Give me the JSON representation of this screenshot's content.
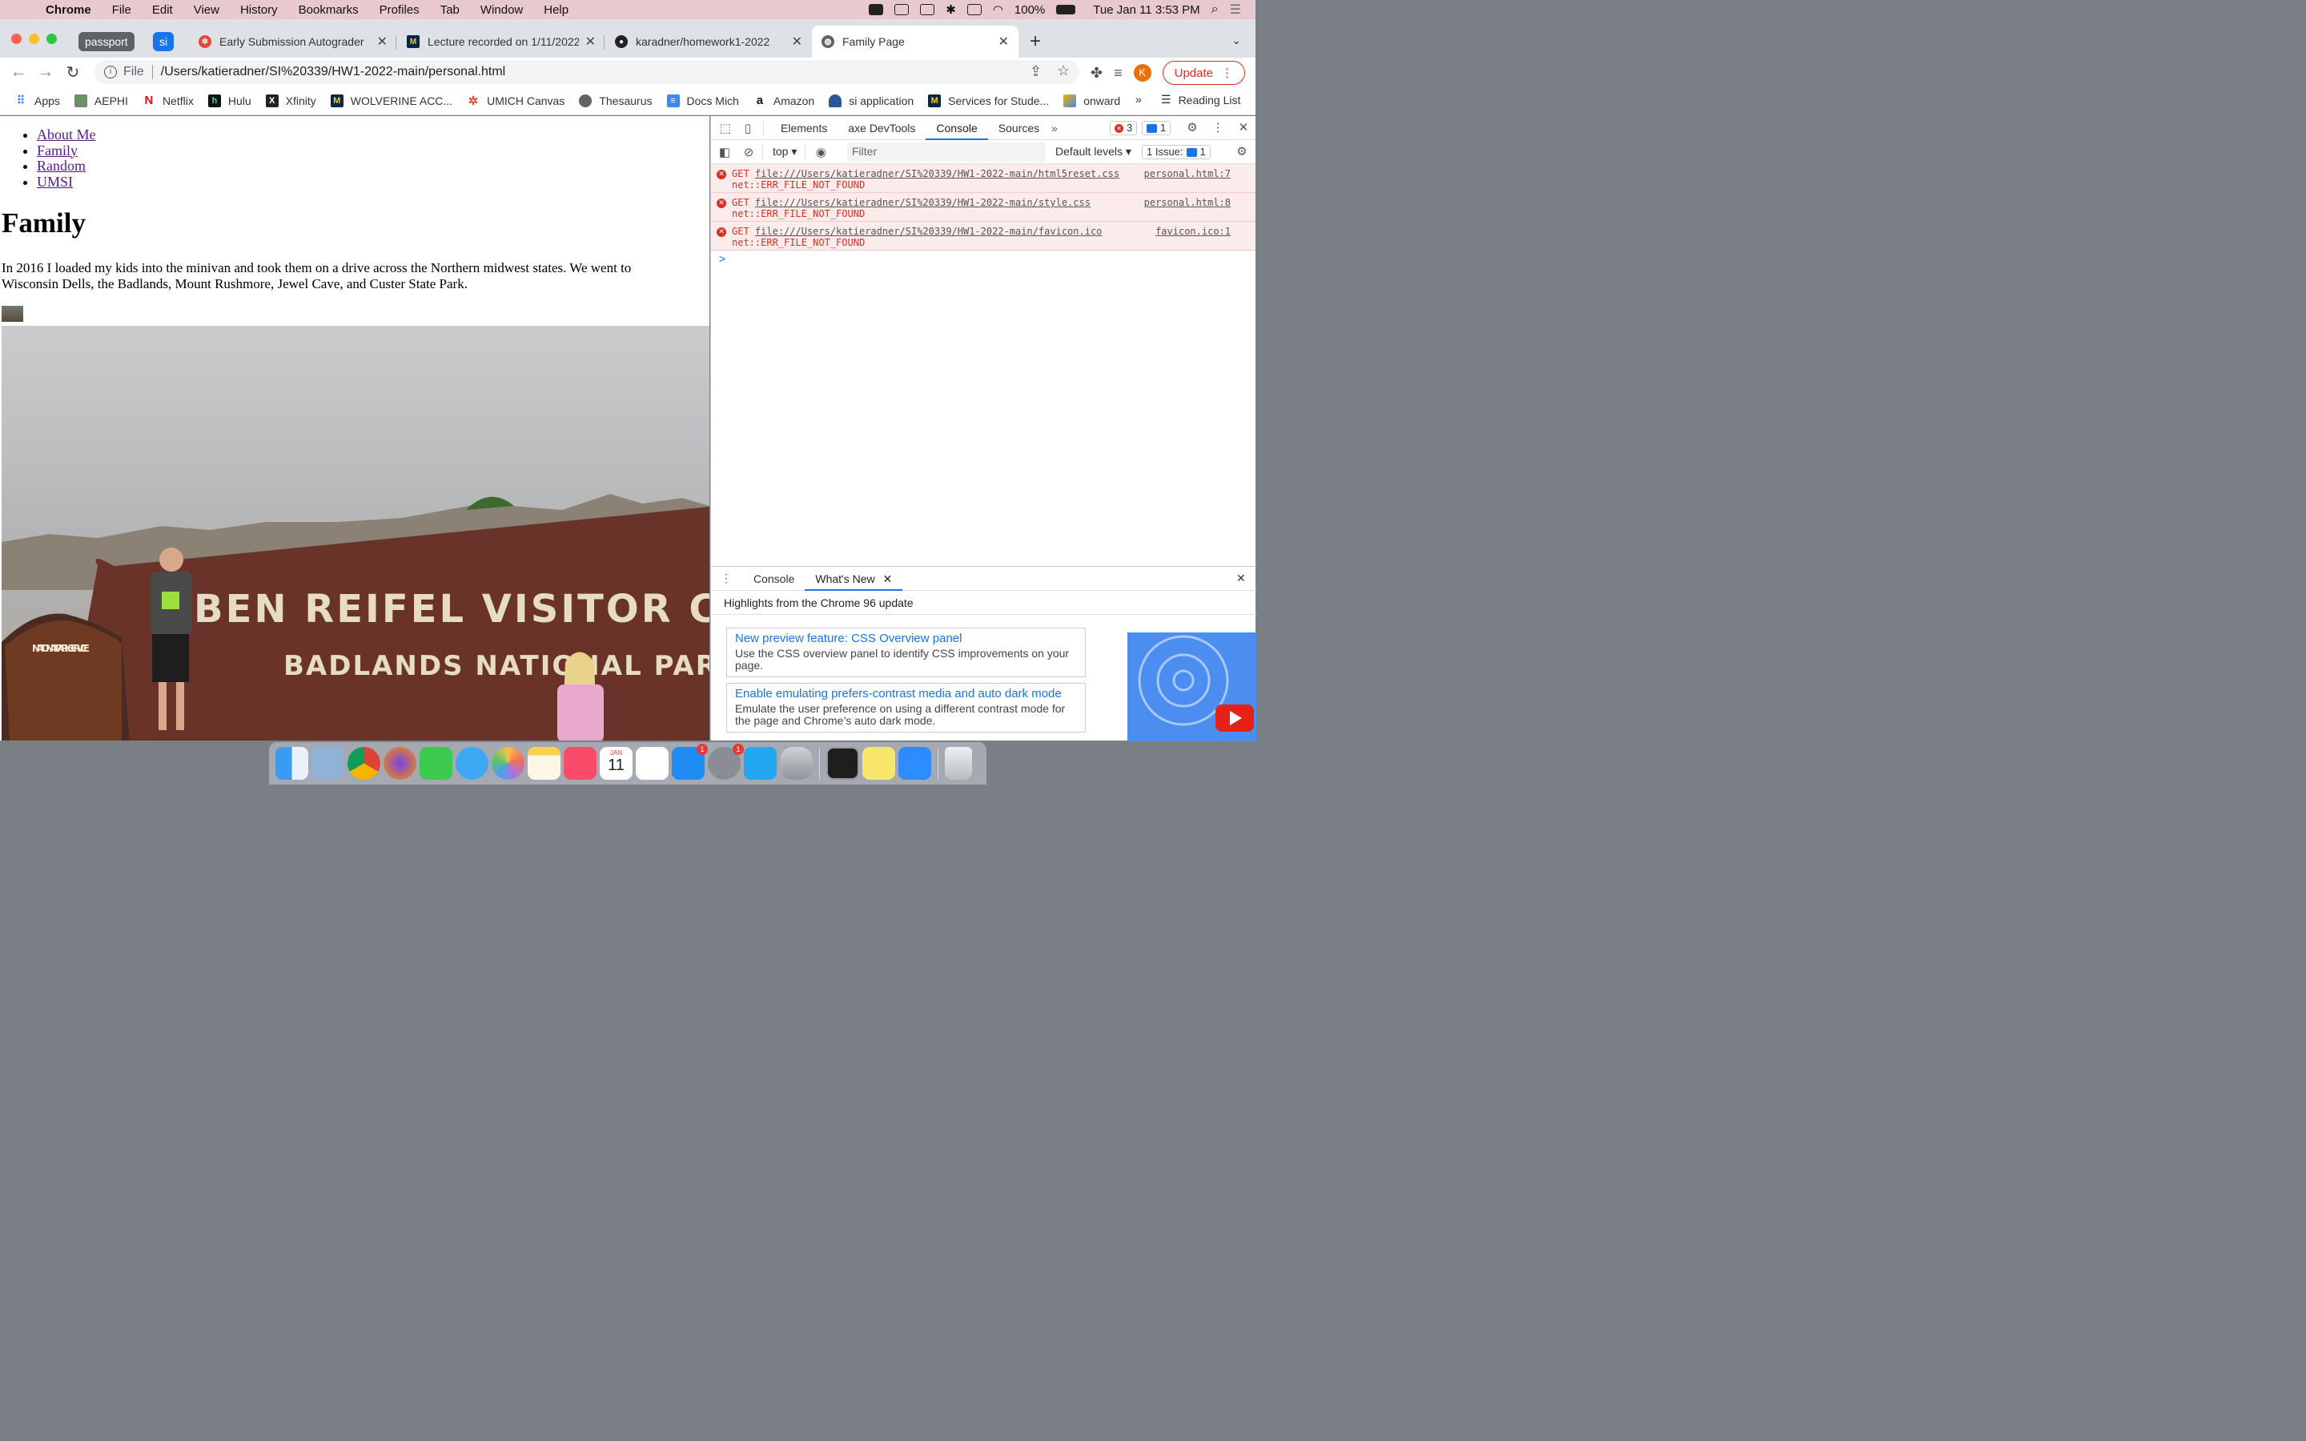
{
  "menubar": {
    "app_name": "Chrome",
    "items": [
      "File",
      "Edit",
      "View",
      "History",
      "Bookmarks",
      "Profiles",
      "Tab",
      "Window",
      "Help"
    ],
    "battery": "100%",
    "clock": "Tue Jan 11  3:53 PM"
  },
  "tabs": {
    "groups": [
      {
        "label": "passport",
        "color": "#5f6368"
      },
      {
        "label": "si",
        "color": "#1a73e8"
      }
    ],
    "items": [
      {
        "title": "Early Submission Autograder",
        "icon": "autograder-icon"
      },
      {
        "title": "Lecture recorded on 1/11/2022",
        "icon": "umich-icon"
      },
      {
        "title": "karadner/homework1-2022",
        "icon": "github-icon"
      },
      {
        "title": "Family Page",
        "icon": "globe-icon"
      }
    ],
    "new_tab": "+"
  },
  "toolbar": {
    "scheme": "File",
    "url": "/Users/katieradner/SI%20339/HW1-2022-main/personal.html",
    "profile_initial": "K",
    "update_label": "Update"
  },
  "bookmarks": {
    "items": [
      "Apps",
      "AEPHI",
      "Netflix",
      "Hulu",
      "Xfinity",
      "WOLVERINE ACC...",
      "UMICH Canvas",
      "Thesaurus",
      "Docs Mich",
      "Amazon",
      "si application",
      "Services for Stude...",
      "onward"
    ],
    "more": "»",
    "reading_list": "Reading List"
  },
  "page": {
    "nav": [
      "About Me",
      "Family",
      "Random",
      "UMSI"
    ],
    "heading": "Family",
    "paragraph": "In 2016 I loaded my kids into the minivan and took them on a drive across the Northern midwest states. We went to Wisconsin Dells, the Badlands, Mount Rushmore, Jewel Cave, and Custer State Park.",
    "photo_sign_line1": "BEN REIFEL VISITOR CENT",
    "photo_sign_line2": "BADLANDS NATIONAL PARK",
    "photo_badge": "NATIONAL PARK SERVICE"
  },
  "devtools": {
    "tabs": [
      "Elements",
      "axe DevTools",
      "Console",
      "Sources"
    ],
    "active_tab": "Console",
    "error_count": "3",
    "message_count": "1",
    "context": "top",
    "filter_placeholder": "Filter",
    "levels": "Default levels",
    "issues_label": "1 Issue:",
    "issues_count": "1",
    "errors": [
      {
        "method": "GET",
        "url": "file:///Users/katieradner/SI%20339/HW1-2022-main/html5reset.css",
        "error": "net::ERR_FILE_NOT_FOUND",
        "source": "personal.html:7"
      },
      {
        "method": "GET",
        "url": "file:///Users/katieradner/SI%20339/HW1-2022-main/style.css",
        "error": "net::ERR_FILE_NOT_FOUND",
        "source": "personal.html:8"
      },
      {
        "method": "GET",
        "url": "file:///Users/katieradner/SI%20339/HW1-2022-main/favicon.ico",
        "error": "net::ERR_FILE_NOT_FOUND",
        "source": "favicon.ico:1"
      }
    ],
    "prompt": ">",
    "drawer": {
      "tabs": [
        "Console",
        "What's New"
      ],
      "subtitle": "Highlights from the Chrome 96 update",
      "cards": [
        {
          "title": "New preview feature: CSS Overview panel",
          "desc": "Use the CSS overview panel to identify CSS improvements on your page."
        },
        {
          "title": "Enable emulating prefers-contrast media and auto dark mode",
          "desc": "Emulate the user preference on using a different contrast mode for the page and Chrome’s auto dark mode."
        }
      ]
    }
  },
  "dock": {
    "calendar_month": "JAN",
    "calendar_day": "11",
    "badges": {
      "appstore": "1",
      "prefs": "1"
    }
  }
}
